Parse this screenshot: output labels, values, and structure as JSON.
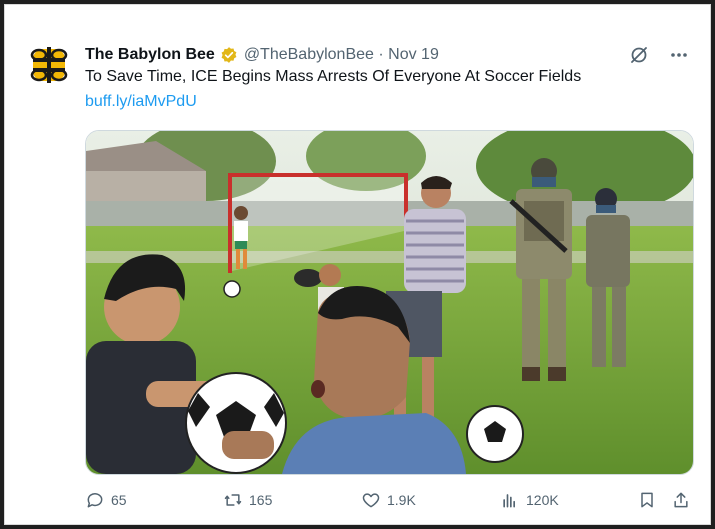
{
  "tweet": {
    "author_name": "The Babylon Bee",
    "handle": "@TheBabylonBee",
    "date": "Nov 19",
    "text": "To Save Time, ICE Begins Mass Arrests Of Everyone At Soccer Fields",
    "link": "buff.ly/iaMvPdU"
  },
  "header_icons": [
    "grok-icon",
    "more-icon"
  ],
  "actions": {
    "replies": "65",
    "reposts": "165",
    "likes": "1.9K",
    "views": "120K"
  },
  "colors": {
    "verified": "#e2b719",
    "link": "#1d9bf0",
    "muted": "#536471"
  }
}
